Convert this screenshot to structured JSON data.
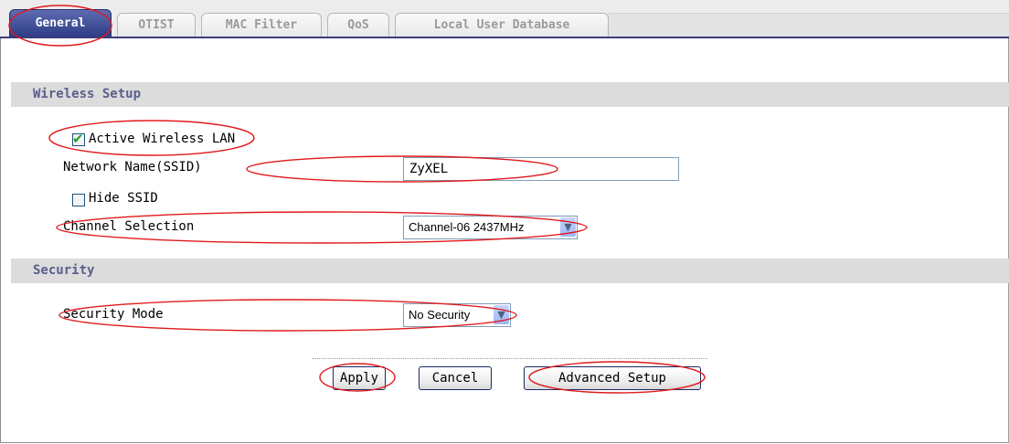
{
  "tabs": [
    "General",
    "OTIST",
    "MAC Filter",
    "QoS",
    "Local User Database"
  ],
  "active_tab": "General",
  "wireless": {
    "header": "Wireless Setup",
    "active_label": "Active Wireless LAN",
    "active_checked": true,
    "ssid_label": "Network Name(SSID)",
    "ssid_value": "ZyXEL",
    "hide_label": "Hide SSID",
    "hide_checked": false,
    "channel_label": "Channel Selection",
    "channel_value": "Channel-06 2437MHz"
  },
  "security": {
    "header": "Security",
    "mode_label": "Security Mode",
    "mode_value": "No Security"
  },
  "buttons": {
    "apply": "Apply",
    "cancel": "Cancel",
    "advanced": "Advanced Setup"
  },
  "colors": {
    "active_tab": "#2d3c86",
    "section_header_bg": "#dcdcdc",
    "section_header_text": "#5a5f8c",
    "annotation": "#e0191c",
    "check_mark": "#21a121"
  }
}
